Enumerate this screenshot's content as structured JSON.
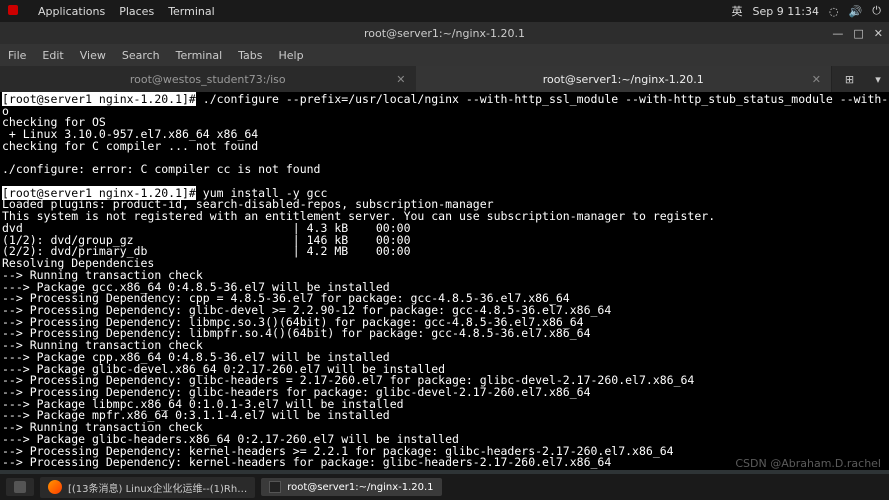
{
  "topbar": {
    "apps": "Applications",
    "places": "Places",
    "terminal": "Terminal",
    "lang": "英",
    "date": "Sep 9  11:34"
  },
  "titlebar": "root@server1:~/nginx-1.20.1",
  "menu": [
    "File",
    "Edit",
    "View",
    "Search",
    "Terminal",
    "Tabs",
    "Help"
  ],
  "tabs": [
    {
      "label": "root@westos_student73:/iso"
    },
    {
      "label": "root@server1:~/nginx-1.20.1"
    }
  ],
  "term": {
    "p1": "[root@server1 nginx-1.20.1]#",
    "l1": " ./configure --prefix=/usr/local/nginx --with-http_ssl_module --with-http_stub_status_module --with-threads --with-file-ai",
    "l1b": "o",
    "l2": "checking for OS",
    "l3": " + Linux 3.10.0-957.el7.x86_64 x86_64",
    "l4": "checking for C compiler ... not found",
    "l5": "",
    "l6": "./configure: error: C compiler cc is not found",
    "l7": "",
    "p2": "[root@server1 nginx-1.20.1]#",
    "l8": " yum install -y gcc",
    "l9": "Loaded plugins: product-id, search-disabled-repos, subscription-manager",
    "l10": "This system is not registered with an entitlement server. You can use subscription-manager to register.",
    "l11": "dvd                                       | 4.3 kB    00:00",
    "l12": "(1/2): dvd/group_gz                       | 146 kB    00:00",
    "l13": "(2/2): dvd/primary_db                     | 4.2 MB    00:00",
    "l14": "Resolving Dependencies",
    "l15": "--> Running transaction check",
    "l16": "---> Package gcc.x86_64 0:4.8.5-36.el7 will be installed",
    "l17": "--> Processing Dependency: cpp = 4.8.5-36.el7 for package: gcc-4.8.5-36.el7.x86_64",
    "l18": "--> Processing Dependency: glibc-devel >= 2.2.90-12 for package: gcc-4.8.5-36.el7.x86_64",
    "l19": "--> Processing Dependency: libmpc.so.3()(64bit) for package: gcc-4.8.5-36.el7.x86_64",
    "l20": "--> Processing Dependency: libmpfr.so.4()(64bit) for package: gcc-4.8.5-36.el7.x86_64",
    "l21": "--> Running transaction check",
    "l22": "---> Package cpp.x86_64 0:4.8.5-36.el7 will be installed",
    "l23": "---> Package glibc-devel.x86_64 0:2.17-260.el7 will be installed",
    "l24": "--> Processing Dependency: glibc-headers = 2.17-260.el7 for package: glibc-devel-2.17-260.el7.x86_64",
    "l25": "--> Processing Dependency: glibc-headers for package: glibc-devel-2.17-260.el7.x86_64",
    "l26": "---> Package libmpc.x86_64 0:1.0.1-3.el7 will be installed",
    "l27": "---> Package mpfr.x86_64 0:3.1.1-4.el7 will be installed",
    "l28": "--> Running transaction check",
    "l29": "---> Package glibc-headers.x86_64 0:2.17-260.el7 will be installed",
    "l30": "--> Processing Dependency: kernel-headers >= 2.2.1 for package: glibc-headers-2.17-260.el7.x86_64",
    "l31": "--> Processing Dependency: kernel-headers for package: glibc-headers-2.17-260.el7.x86_64"
  },
  "taskbar": {
    "ff": "[(13条消息) Linux企业化运维--(1)Rh…",
    "term": "root@server1:~/nginx-1.20.1"
  },
  "watermark": "CSDN @Abraham.D.rachel"
}
